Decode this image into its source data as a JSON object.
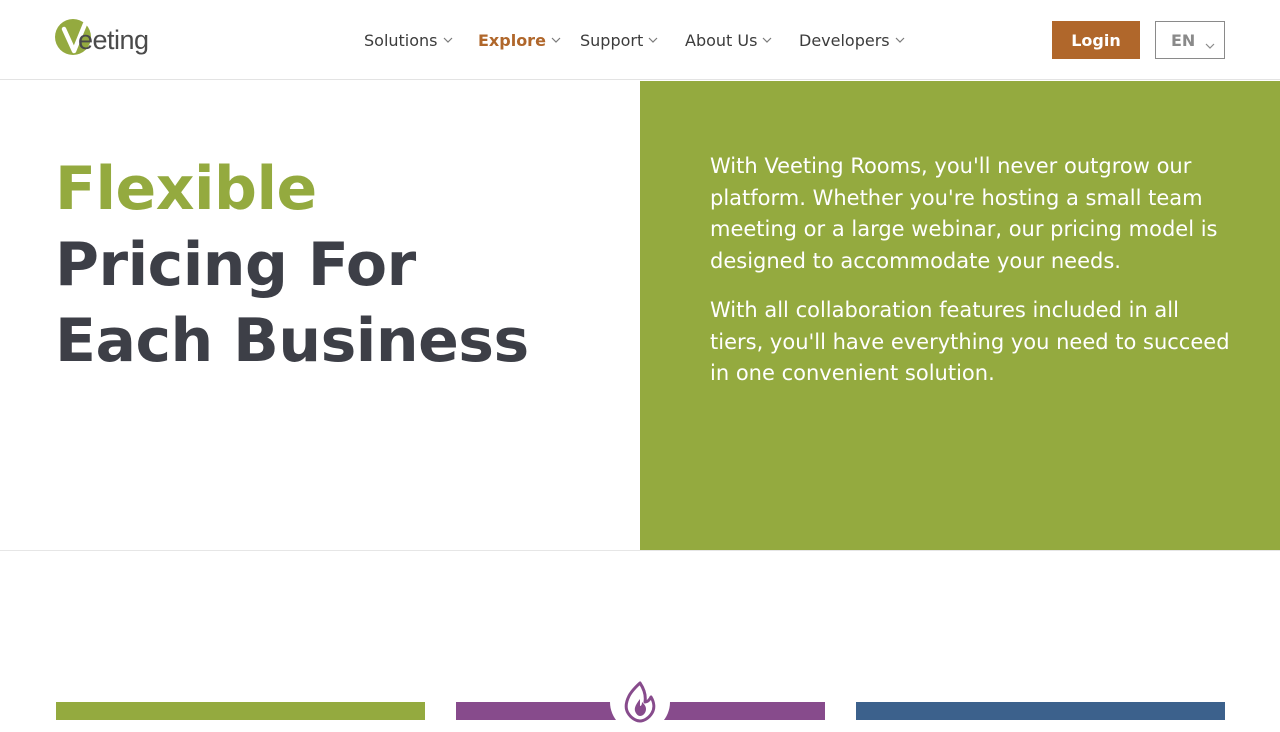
{
  "header": {
    "logo_text": "eeting",
    "nav": [
      {
        "label": "Solutions",
        "active": false
      },
      {
        "label": "Explore",
        "active": true
      },
      {
        "label": "Support",
        "active": false
      },
      {
        "label": "About Us",
        "active": false
      },
      {
        "label": "Developers",
        "active": false
      }
    ],
    "login_label": "Login",
    "language": "EN"
  },
  "hero": {
    "title_accent": "Flexible",
    "title_line2": "Pricing For",
    "title_line3": "Each Business",
    "paragraph1": "With Veeting Rooms, you'll never outgrow our platform. Whether you're hosting a small team meeting or a large webinar, our pricing model is designed to accommodate your needs.",
    "paragraph2": "With all collaboration features included in all tiers, you'll have everything you need to succeed in one convenient solution."
  },
  "pricing_cards": [
    {
      "color": "#94aa3f",
      "icon": "none"
    },
    {
      "color": "#874b8c",
      "icon": "flame-icon"
    },
    {
      "color": "#3c618c",
      "icon": "none"
    }
  ],
  "colors": {
    "brand_green": "#94aa3f",
    "accent_orange": "#b0672b",
    "heading_dark": "#3d3f47",
    "purple": "#874b8c",
    "blue": "#3c618c"
  }
}
